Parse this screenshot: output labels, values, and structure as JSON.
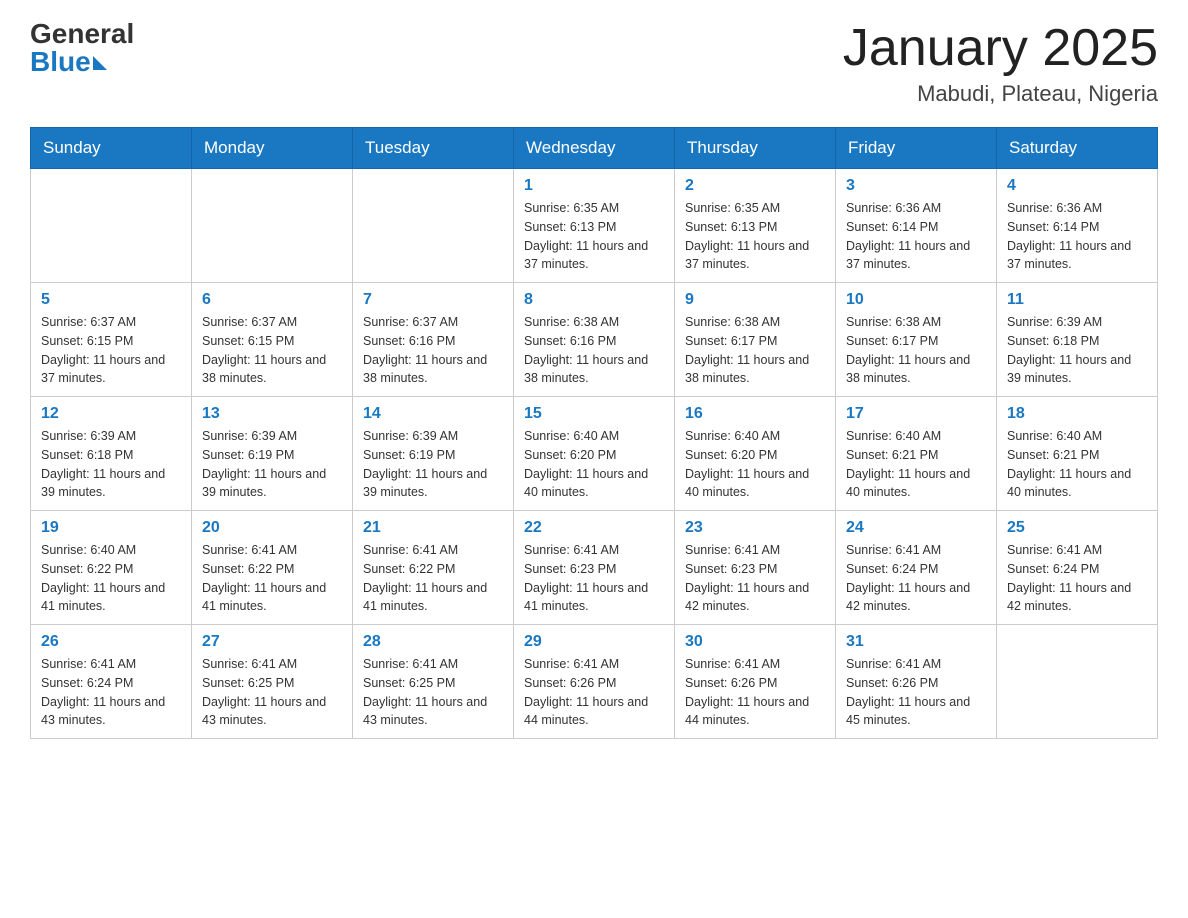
{
  "header": {
    "logo_general": "General",
    "logo_blue": "Blue",
    "month_title": "January 2025",
    "location": "Mabudi, Plateau, Nigeria"
  },
  "calendar": {
    "days_of_week": [
      "Sunday",
      "Monday",
      "Tuesday",
      "Wednesday",
      "Thursday",
      "Friday",
      "Saturday"
    ],
    "weeks": [
      [
        {
          "day": "",
          "sunrise": "",
          "sunset": "",
          "daylight": ""
        },
        {
          "day": "",
          "sunrise": "",
          "sunset": "",
          "daylight": ""
        },
        {
          "day": "",
          "sunrise": "",
          "sunset": "",
          "daylight": ""
        },
        {
          "day": "1",
          "sunrise": "Sunrise: 6:35 AM",
          "sunset": "Sunset: 6:13 PM",
          "daylight": "Daylight: 11 hours and 37 minutes."
        },
        {
          "day": "2",
          "sunrise": "Sunrise: 6:35 AM",
          "sunset": "Sunset: 6:13 PM",
          "daylight": "Daylight: 11 hours and 37 minutes."
        },
        {
          "day": "3",
          "sunrise": "Sunrise: 6:36 AM",
          "sunset": "Sunset: 6:14 PM",
          "daylight": "Daylight: 11 hours and 37 minutes."
        },
        {
          "day": "4",
          "sunrise": "Sunrise: 6:36 AM",
          "sunset": "Sunset: 6:14 PM",
          "daylight": "Daylight: 11 hours and 37 minutes."
        }
      ],
      [
        {
          "day": "5",
          "sunrise": "Sunrise: 6:37 AM",
          "sunset": "Sunset: 6:15 PM",
          "daylight": "Daylight: 11 hours and 37 minutes."
        },
        {
          "day": "6",
          "sunrise": "Sunrise: 6:37 AM",
          "sunset": "Sunset: 6:15 PM",
          "daylight": "Daylight: 11 hours and 38 minutes."
        },
        {
          "day": "7",
          "sunrise": "Sunrise: 6:37 AM",
          "sunset": "Sunset: 6:16 PM",
          "daylight": "Daylight: 11 hours and 38 minutes."
        },
        {
          "day": "8",
          "sunrise": "Sunrise: 6:38 AM",
          "sunset": "Sunset: 6:16 PM",
          "daylight": "Daylight: 11 hours and 38 minutes."
        },
        {
          "day": "9",
          "sunrise": "Sunrise: 6:38 AM",
          "sunset": "Sunset: 6:17 PM",
          "daylight": "Daylight: 11 hours and 38 minutes."
        },
        {
          "day": "10",
          "sunrise": "Sunrise: 6:38 AM",
          "sunset": "Sunset: 6:17 PM",
          "daylight": "Daylight: 11 hours and 38 minutes."
        },
        {
          "day": "11",
          "sunrise": "Sunrise: 6:39 AM",
          "sunset": "Sunset: 6:18 PM",
          "daylight": "Daylight: 11 hours and 39 minutes."
        }
      ],
      [
        {
          "day": "12",
          "sunrise": "Sunrise: 6:39 AM",
          "sunset": "Sunset: 6:18 PM",
          "daylight": "Daylight: 11 hours and 39 minutes."
        },
        {
          "day": "13",
          "sunrise": "Sunrise: 6:39 AM",
          "sunset": "Sunset: 6:19 PM",
          "daylight": "Daylight: 11 hours and 39 minutes."
        },
        {
          "day": "14",
          "sunrise": "Sunrise: 6:39 AM",
          "sunset": "Sunset: 6:19 PM",
          "daylight": "Daylight: 11 hours and 39 minutes."
        },
        {
          "day": "15",
          "sunrise": "Sunrise: 6:40 AM",
          "sunset": "Sunset: 6:20 PM",
          "daylight": "Daylight: 11 hours and 40 minutes."
        },
        {
          "day": "16",
          "sunrise": "Sunrise: 6:40 AM",
          "sunset": "Sunset: 6:20 PM",
          "daylight": "Daylight: 11 hours and 40 minutes."
        },
        {
          "day": "17",
          "sunrise": "Sunrise: 6:40 AM",
          "sunset": "Sunset: 6:21 PM",
          "daylight": "Daylight: 11 hours and 40 minutes."
        },
        {
          "day": "18",
          "sunrise": "Sunrise: 6:40 AM",
          "sunset": "Sunset: 6:21 PM",
          "daylight": "Daylight: 11 hours and 40 minutes."
        }
      ],
      [
        {
          "day": "19",
          "sunrise": "Sunrise: 6:40 AM",
          "sunset": "Sunset: 6:22 PM",
          "daylight": "Daylight: 11 hours and 41 minutes."
        },
        {
          "day": "20",
          "sunrise": "Sunrise: 6:41 AM",
          "sunset": "Sunset: 6:22 PM",
          "daylight": "Daylight: 11 hours and 41 minutes."
        },
        {
          "day": "21",
          "sunrise": "Sunrise: 6:41 AM",
          "sunset": "Sunset: 6:22 PM",
          "daylight": "Daylight: 11 hours and 41 minutes."
        },
        {
          "day": "22",
          "sunrise": "Sunrise: 6:41 AM",
          "sunset": "Sunset: 6:23 PM",
          "daylight": "Daylight: 11 hours and 41 minutes."
        },
        {
          "day": "23",
          "sunrise": "Sunrise: 6:41 AM",
          "sunset": "Sunset: 6:23 PM",
          "daylight": "Daylight: 11 hours and 42 minutes."
        },
        {
          "day": "24",
          "sunrise": "Sunrise: 6:41 AM",
          "sunset": "Sunset: 6:24 PM",
          "daylight": "Daylight: 11 hours and 42 minutes."
        },
        {
          "day": "25",
          "sunrise": "Sunrise: 6:41 AM",
          "sunset": "Sunset: 6:24 PM",
          "daylight": "Daylight: 11 hours and 42 minutes."
        }
      ],
      [
        {
          "day": "26",
          "sunrise": "Sunrise: 6:41 AM",
          "sunset": "Sunset: 6:24 PM",
          "daylight": "Daylight: 11 hours and 43 minutes."
        },
        {
          "day": "27",
          "sunrise": "Sunrise: 6:41 AM",
          "sunset": "Sunset: 6:25 PM",
          "daylight": "Daylight: 11 hours and 43 minutes."
        },
        {
          "day": "28",
          "sunrise": "Sunrise: 6:41 AM",
          "sunset": "Sunset: 6:25 PM",
          "daylight": "Daylight: 11 hours and 43 minutes."
        },
        {
          "day": "29",
          "sunrise": "Sunrise: 6:41 AM",
          "sunset": "Sunset: 6:26 PM",
          "daylight": "Daylight: 11 hours and 44 minutes."
        },
        {
          "day": "30",
          "sunrise": "Sunrise: 6:41 AM",
          "sunset": "Sunset: 6:26 PM",
          "daylight": "Daylight: 11 hours and 44 minutes."
        },
        {
          "day": "31",
          "sunrise": "Sunrise: 6:41 AM",
          "sunset": "Sunset: 6:26 PM",
          "daylight": "Daylight: 11 hours and 45 minutes."
        },
        {
          "day": "",
          "sunrise": "",
          "sunset": "",
          "daylight": ""
        }
      ]
    ]
  }
}
